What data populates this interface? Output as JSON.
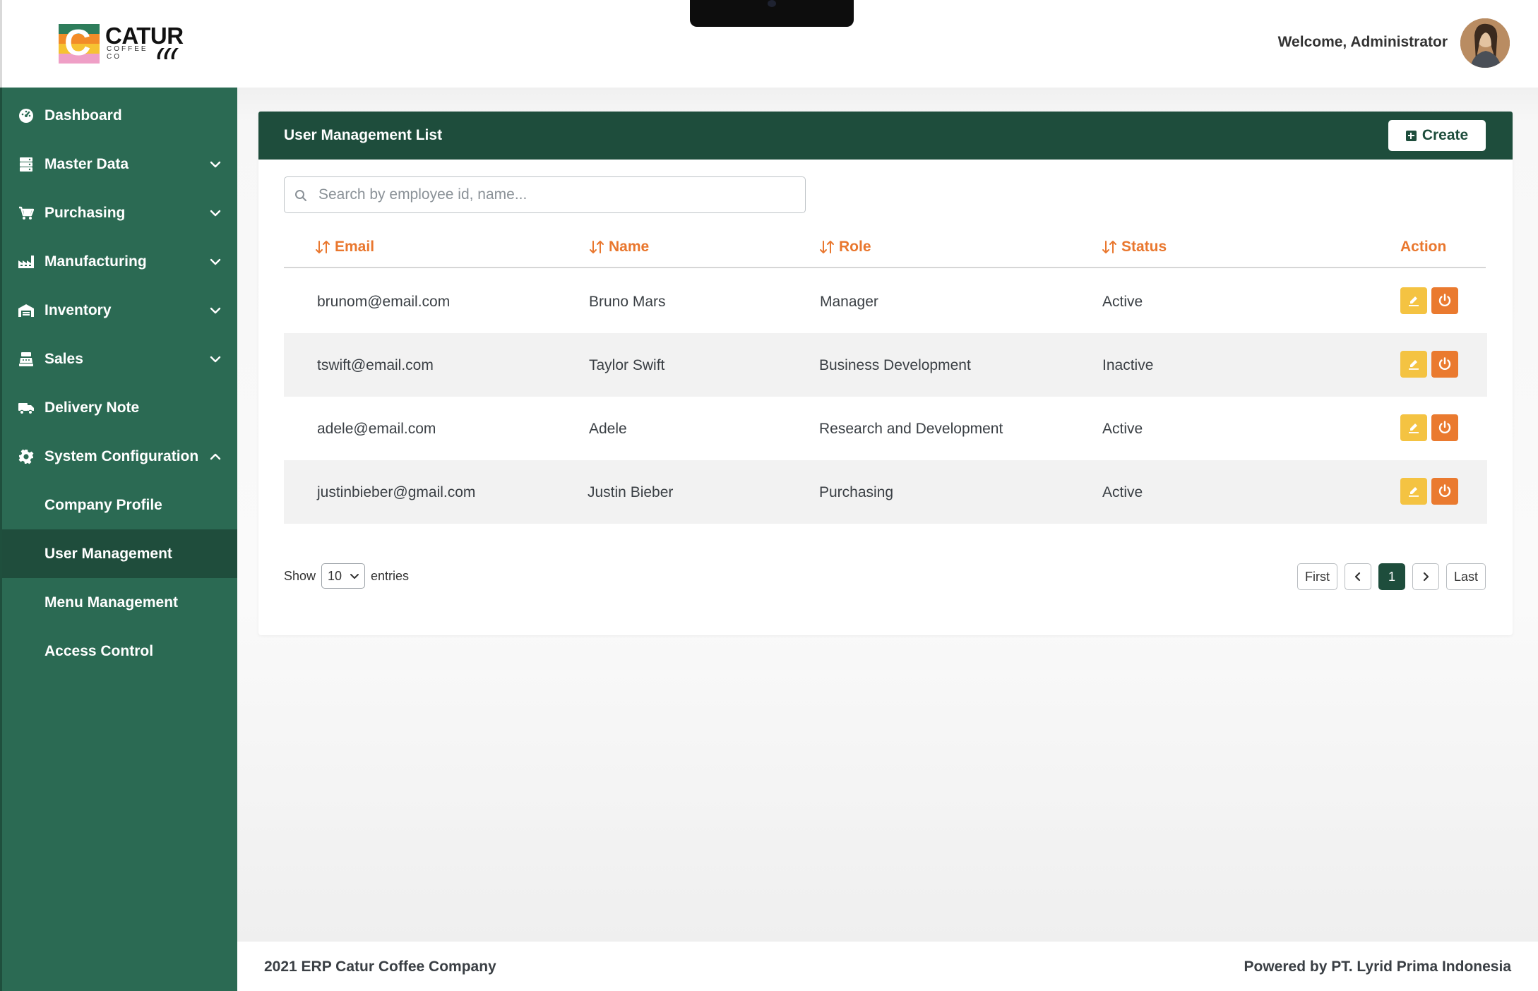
{
  "app": {
    "logo_text": "CATUR",
    "logo_sub": "COFFEE CO",
    "welcome": "Welcome, Administrator"
  },
  "colors": {
    "sidebar_bg": "#2b6a53",
    "sidebar_active": "#1f4d3c",
    "header_green": "#1e4d3c",
    "accent_orange": "#e9772e",
    "edit_yellow": "#f4c342"
  },
  "sidebar": {
    "items": [
      {
        "label": "Dashboard",
        "icon": "dashboard-gauge-icon"
      },
      {
        "label": "Master Data",
        "icon": "server-icon",
        "chevron": "chevron-down-icon"
      },
      {
        "label": "Purchasing",
        "icon": "cart-icon",
        "chevron": "chevron-down-icon"
      },
      {
        "label": "Manufacturing",
        "icon": "factory-icon",
        "chevron": "chevron-down-icon"
      },
      {
        "label": "Inventory",
        "icon": "warehouse-icon",
        "chevron": "chevron-down-icon"
      },
      {
        "label": "Sales",
        "icon": "cash-register-icon",
        "chevron": "chevron-down-icon"
      },
      {
        "label": "Delivery Note",
        "icon": "truck-icon"
      },
      {
        "label": "System Configuration",
        "icon": "gear-icon",
        "chevron": "chevron-up-icon"
      },
      {
        "label": "Company Profile"
      },
      {
        "label": "User Management",
        "active": true
      },
      {
        "label": "Menu Management"
      },
      {
        "label": "Access Control"
      }
    ]
  },
  "main": {
    "card_title": "User Management List",
    "create_label": "Create",
    "search_placeholder": "Search by employee id, name...",
    "columns": [
      "Email",
      "Name",
      "Role",
      "Status",
      "Action"
    ],
    "rows": [
      {
        "email": "brunom@email.com",
        "name": "Bruno Mars",
        "role": "Manager",
        "status": "Active"
      },
      {
        "email": "tswift@email.com",
        "name": "Taylor Swift",
        "role": "Business Development",
        "status": "Inactive"
      },
      {
        "email": "adele@email.com",
        "name": "Adele",
        "role": "Research and Development",
        "status": "Active"
      },
      {
        "email": "justinbieber@gmail.com",
        "name": "Justin Bieber",
        "role": "Purchasing",
        "status": "Active"
      }
    ],
    "show_label": "Show",
    "entries_value": "10",
    "entries_label": "entries",
    "pagination": {
      "first": "First",
      "current": "1",
      "last": "Last"
    }
  },
  "footer": {
    "left": "2021 ERP Catur Coffee Company",
    "right": "Powered by PT. Lyrid Prima Indonesia"
  }
}
